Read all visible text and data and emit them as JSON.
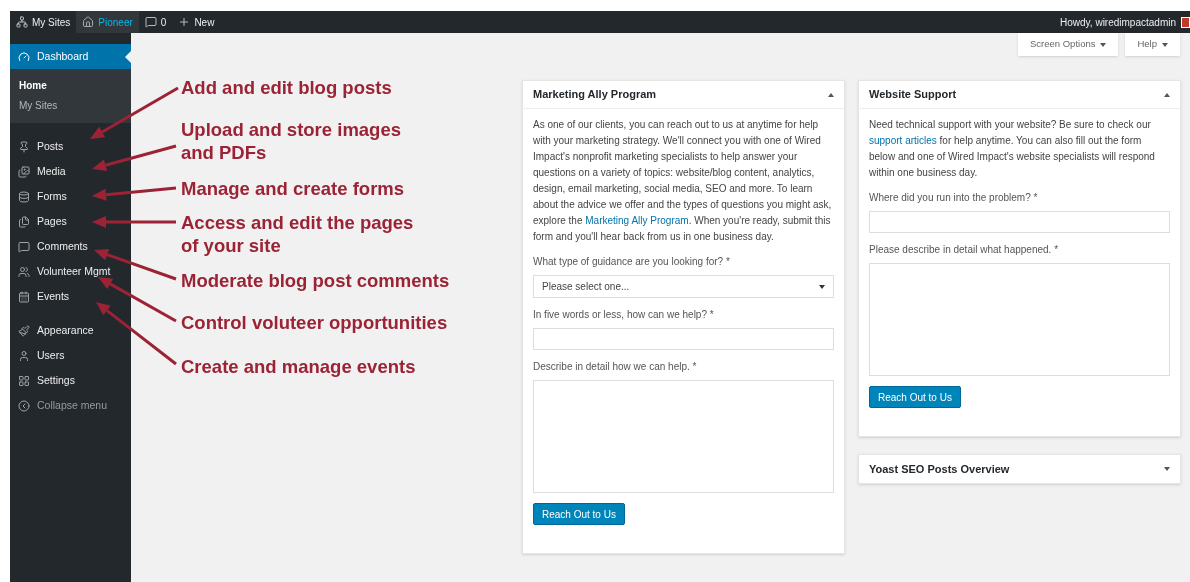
{
  "admin_bar": {
    "items": [
      {
        "kind": "sites",
        "label": "My Sites",
        "selected": false
      },
      {
        "kind": "home",
        "label": "Pioneer",
        "selected": true
      },
      {
        "kind": "comments",
        "label": "0",
        "selected": false
      },
      {
        "kind": "new",
        "label": "New",
        "selected": false
      }
    ],
    "greeting": "Howdy, wiredimpactadmin"
  },
  "sidebar": {
    "groups": [
      [
        {
          "kind": "dashboard",
          "label": "Dashboard",
          "selected": true,
          "children": [
            {
              "label": "Home",
              "selected": true
            },
            {
              "label": "My Sites",
              "selected": false
            }
          ]
        }
      ],
      [
        {
          "kind": "posts",
          "label": "Posts",
          "selected": false
        },
        {
          "kind": "media",
          "label": "Media",
          "selected": false
        },
        {
          "kind": "forms",
          "label": "Forms",
          "selected": false
        },
        {
          "kind": "pages",
          "label": "Pages",
          "selected": false
        },
        {
          "kind": "comments",
          "label": "Comments",
          "selected": false
        },
        {
          "kind": "volunteer",
          "label": "Volunteer Mgmt",
          "selected": false
        },
        {
          "kind": "events",
          "label": "Events",
          "selected": false
        }
      ],
      [
        {
          "kind": "appearance",
          "label": "Appearance",
          "selected": false
        },
        {
          "kind": "users",
          "label": "Users",
          "selected": false
        },
        {
          "kind": "settings",
          "label": "Settings",
          "selected": false
        },
        {
          "kind": "collapse",
          "label": "Collapse menu",
          "selected": false
        }
      ]
    ]
  },
  "top_buttons": [
    "Screen Options",
    "Help"
  ],
  "annotations": [
    {
      "lines": [
        "Add and edit blog posts"
      ]
    },
    {
      "lines": [
        "Upload and store images",
        "and PDFs"
      ]
    },
    {
      "lines": [
        "Manage and create forms"
      ]
    },
    {
      "lines": [
        "Access and edit the pages",
        "of your site"
      ]
    },
    {
      "lines": [
        "Moderate blog post comments"
      ]
    },
    {
      "lines": [
        "Control voluteer opportunities"
      ]
    },
    {
      "lines": [
        "Create and manage events"
      ]
    }
  ],
  "columns": [
    [
      {
        "title": "Marketing Ally Program",
        "expanded": true,
        "intro": [
          {
            "kind": "text",
            "text": "As one of our clients, you can reach out to us at anytime for help with your marketing strategy. We'll connect you with one of Wired Impact's nonprofit marketing specialists to help answer your questions on a variety of topics: website/blog content, analytics, design, email marketing, social media, SEO and more. To learn about the advice we offer and the types of questions you might ask, explore the "
          },
          {
            "kind": "link",
            "text": "Marketing Ally Program"
          },
          {
            "kind": "text",
            "text": ". When you're ready, submit this form and you'll hear back from us in one business day."
          }
        ],
        "fields": [
          {
            "kind": "select",
            "label": "What type of guidance are you looking for? *",
            "value": "Please select one..."
          },
          {
            "kind": "text",
            "label": "In five words or less, how can we help? *"
          },
          {
            "kind": "textarea",
            "label": "Describe in detail how we can help. *"
          }
        ],
        "button": "Reach Out to Us"
      }
    ],
    [
      {
        "title": "Website Support",
        "expanded": true,
        "intro": [
          {
            "kind": "text",
            "text": "Need technical support with your website? Be sure to check our "
          },
          {
            "kind": "link",
            "text": "support articles"
          },
          {
            "kind": "text",
            "text": " for help anytime. You can also fill out the form below and one of Wired Impact's website specialists will respond within one business day."
          }
        ],
        "fields": [
          {
            "kind": "text",
            "label": "Where did you run into the problem? *"
          },
          {
            "kind": "textarea",
            "label": "Please describe in detail what happened. *"
          }
        ],
        "button": "Reach Out to Us"
      },
      {
        "title": "Yoast SEO Posts Overview",
        "expanded": false
      }
    ]
  ]
}
